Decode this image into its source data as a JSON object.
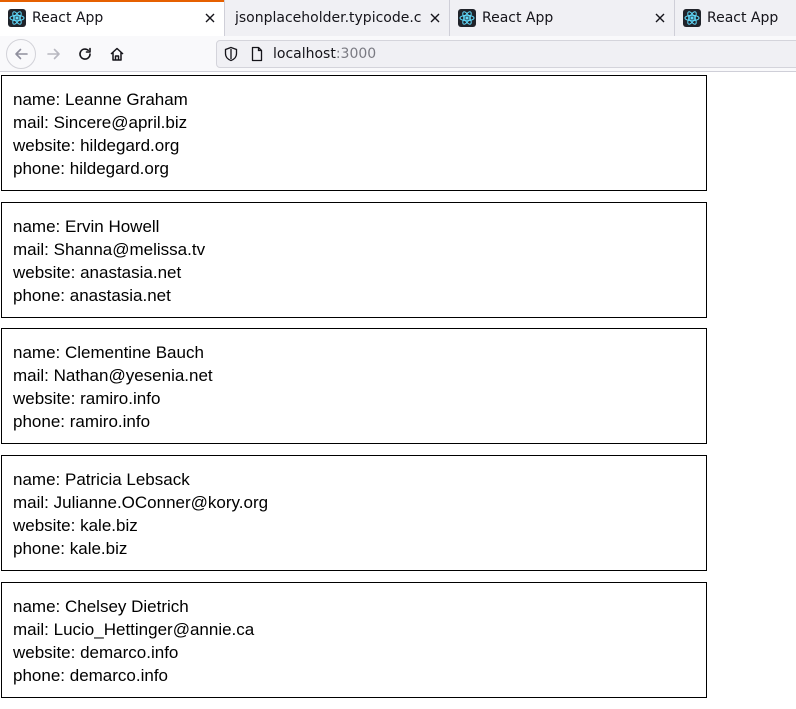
{
  "browser": {
    "tabs": [
      {
        "title": "React App",
        "active": true,
        "closable": true,
        "icon": "react-icon"
      },
      {
        "title": "jsonplaceholder.typicode.com",
        "active": false,
        "closable": true,
        "icon": "page-icon"
      },
      {
        "title": "React App",
        "active": false,
        "closable": true,
        "icon": "react-icon"
      },
      {
        "title": "React App",
        "active": false,
        "closable": false,
        "icon": "react-icon"
      }
    ],
    "url": {
      "host": "localhost",
      "port": ":3000"
    }
  },
  "labels": {
    "name": "name: ",
    "mail": "mail: ",
    "website": "website: ",
    "phone": "phone: "
  },
  "users": [
    {
      "name": "Leanne Graham",
      "mail": "Sincere@april.biz",
      "website": "hildegard.org",
      "phone": "hildegard.org"
    },
    {
      "name": "Ervin Howell",
      "mail": "Shanna@melissa.tv",
      "website": "anastasia.net",
      "phone": "anastasia.net"
    },
    {
      "name": "Clementine Bauch",
      "mail": "Nathan@yesenia.net",
      "website": "ramiro.info",
      "phone": "ramiro.info"
    },
    {
      "name": "Patricia Lebsack",
      "mail": "Julianne.OConner@kory.org",
      "website": "kale.biz",
      "phone": "kale.biz"
    },
    {
      "name": "Chelsey Dietrich",
      "mail": "Lucio_Hettinger@annie.ca",
      "website": "demarco.info",
      "phone": "demarco.info"
    }
  ],
  "colors": {
    "active_tab_accent": "#e66000",
    "react_logo": "#61dafb",
    "react_logo_bg": "#20232a"
  }
}
